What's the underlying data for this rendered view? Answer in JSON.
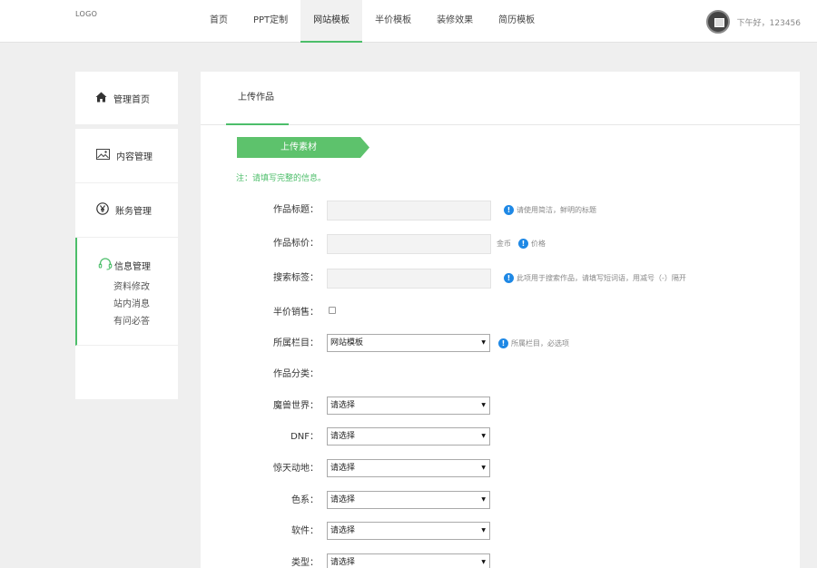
{
  "header": {
    "logo": "LOGO",
    "nav": [
      "首页",
      "PPT定制",
      "网站模板",
      "半价模板",
      "装修效果",
      "简历模板"
    ],
    "active_index": 2,
    "greeting": "下午好，123456",
    "accent_color": "#4cbe6a"
  },
  "sidebar": {
    "home": "管理首页",
    "items": [
      "内容管理",
      "账务管理"
    ],
    "info": "信息管理",
    "sub_items": [
      "资料修改",
      "站内消息",
      "有问必答"
    ]
  },
  "main": {
    "tab": "上传作品",
    "ribbon": "上传素材",
    "note": "注：请填写完整的信息。",
    "fields": {
      "title": {
        "label": "作品标题：",
        "hint": "请使用简洁，鲜明的标题"
      },
      "price": {
        "label": "作品标价：",
        "unit": "金币",
        "hint": "价格"
      },
      "tags": {
        "label": "搜索标签：",
        "hint": "此项用于搜索作品，请填写短词语，用减号（-）隔开"
      },
      "half_price": {
        "label": "半价销售：",
        "checked": false
      },
      "column": {
        "label": "所属栏目：",
        "value": "网站模板",
        "hint": "所属栏目，必选项"
      },
      "category": {
        "label": "作品分类："
      },
      "warcraft": {
        "label": "魔兽世界：",
        "value": "请选择"
      },
      "dnf": {
        "label": "DNF：",
        "value": "请选择"
      },
      "jingtian": {
        "label": "惊天动地：",
        "value": "请选择"
      },
      "color": {
        "label": "色系：",
        "value": "请选择"
      },
      "software": {
        "label": "软件：",
        "value": "请选择"
      },
      "type": {
        "label": "类型：",
        "value": "请选择"
      }
    }
  },
  "icons": {
    "home": "home-icon",
    "content": "image-icon",
    "finance": "yen-icon",
    "info": "headset-icon",
    "hint": "info-icon",
    "dropdown": "caret-down-icon"
  }
}
